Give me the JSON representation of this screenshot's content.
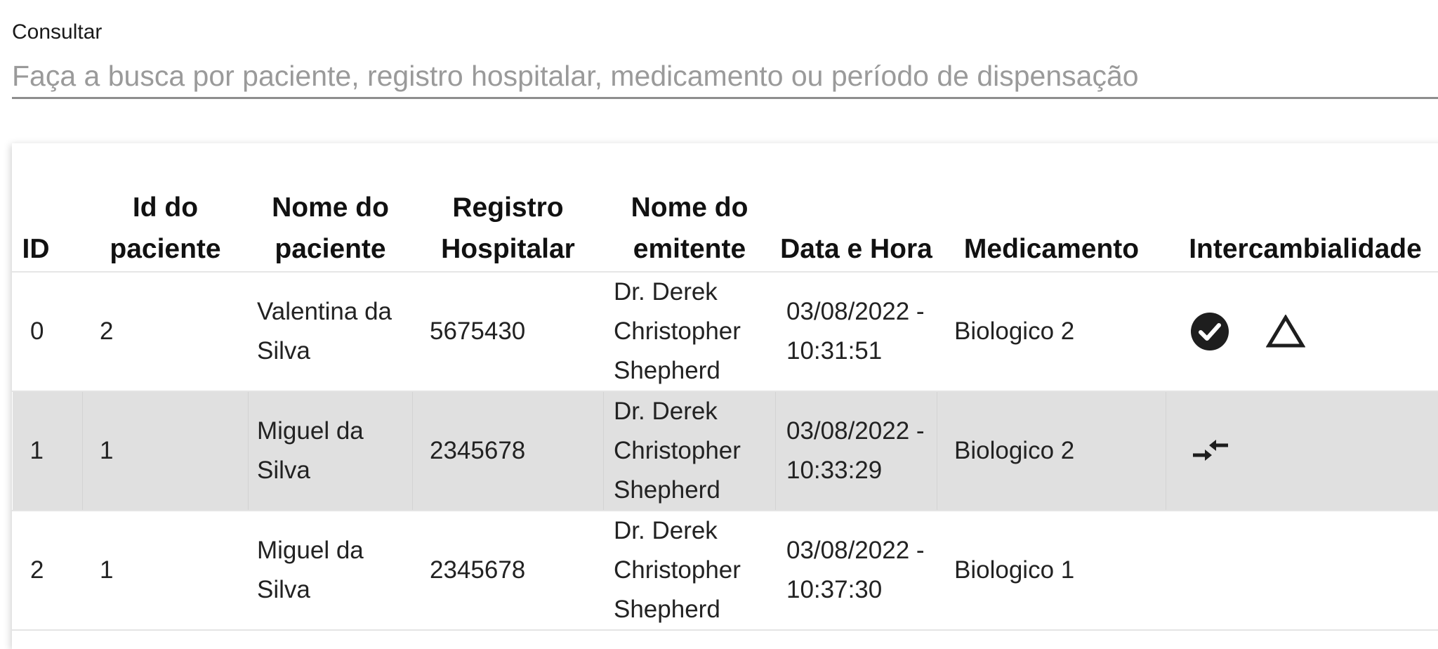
{
  "search": {
    "label": "Consultar",
    "placeholder": "Faça a busca por paciente, registro hospitalar, medicamento ou período de dispensação",
    "value": ""
  },
  "table": {
    "headers": {
      "id": "ID",
      "patient_id": "Id do paciente",
      "patient_name": "Nome do paciente",
      "hospital_record": "Registro Hospitalar",
      "issuer_name": "Nome do emitente",
      "datetime": "Data e Hora",
      "medication": "Medicamento",
      "interchangeability": "Intercambialidade"
    },
    "rows": [
      {
        "id": "0",
        "patient_id": "2",
        "patient_name": "Valentina da Silva",
        "hospital_record": "5675430",
        "issuer_name": "Dr. Derek Christopher Shepherd",
        "datetime": "03/08/2022 - 10:31:51",
        "medication": "Biologico 2",
        "icons": [
          "check-circle-icon",
          "warning-triangle-icon"
        ]
      },
      {
        "id": "1",
        "patient_id": "1",
        "patient_name": "Miguel da Silva",
        "hospital_record": "2345678",
        "issuer_name": "Dr. Derek Christopher Shepherd",
        "datetime": "03/08/2022 - 10:33:29",
        "medication": "Biologico 2",
        "icons": [
          "swap-arrows-icon"
        ]
      },
      {
        "id": "2",
        "patient_id": "1",
        "patient_name": "Miguel da Silva",
        "hospital_record": "2345678",
        "issuer_name": "Dr. Derek Christopher Shepherd",
        "datetime": "03/08/2022 - 10:37:30",
        "medication": "Biologico 1",
        "icons": []
      }
    ]
  },
  "colors": {
    "alt_row": "#e0e0e0",
    "icon": "#1e1e1e",
    "placeholder": "#9a9a9a"
  }
}
